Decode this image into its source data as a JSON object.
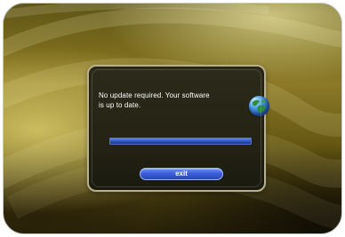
{
  "dialog": {
    "message_line1": "No update required. Your software",
    "message_line2": "is up to date.",
    "progress_fraction": 1.0,
    "exit_label": "exit"
  },
  "icons": {
    "status": "globe-icon"
  },
  "colors": {
    "background_gold": "#8c7a28",
    "dialog_bg": "#242314",
    "dialog_border": "#b9b18b",
    "progress_blue": "#2e55b8",
    "button_blue": "#3c5fd8"
  }
}
